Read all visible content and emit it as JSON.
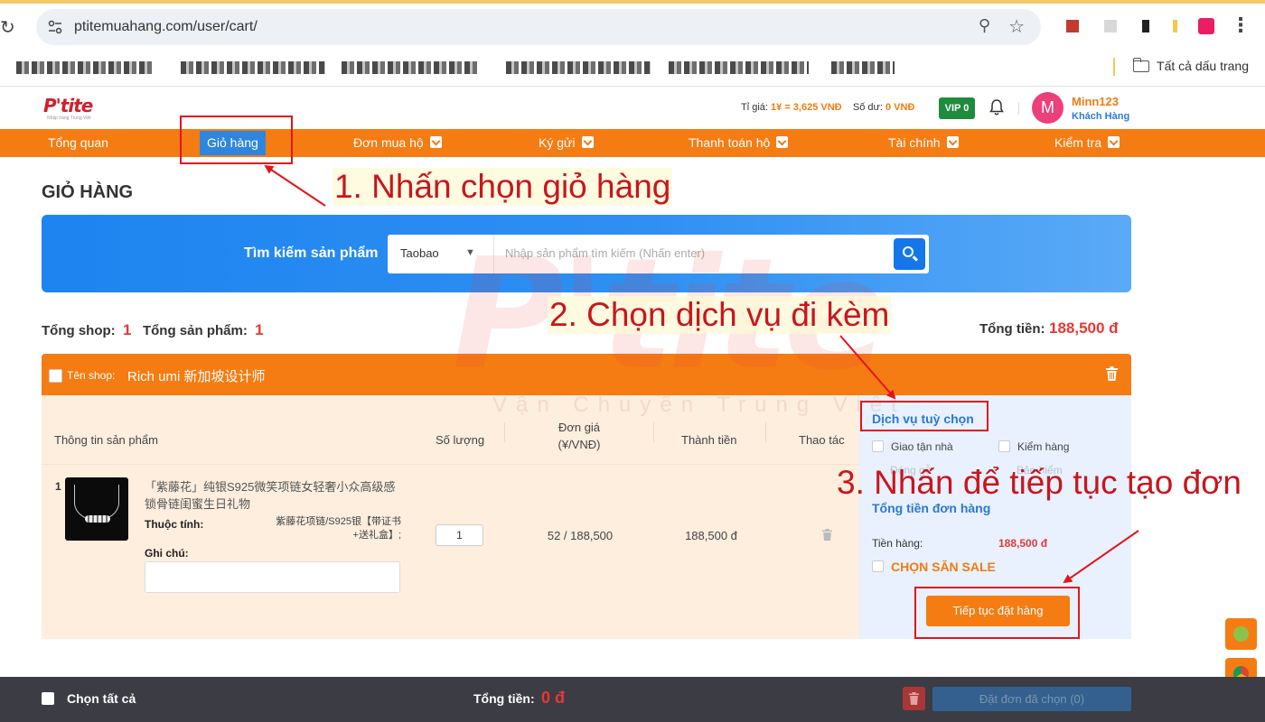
{
  "browser": {
    "url": "ptitemuahang.com/user/cart/",
    "bookmarks_all": "Tất cả dấu trang"
  },
  "header": {
    "logo": "P'tite",
    "logo_sub": "Nhập hàng Trung Việt",
    "rate_label": "Tỉ giá:",
    "rate_value": "1¥ = 3,625 VNĐ",
    "balance_label": "Số dư:",
    "balance_value": "0 VNĐ",
    "vip": "VIP 0",
    "avatar_letter": "M",
    "username": "Minn123",
    "user_role": "Khách Hàng"
  },
  "nav": {
    "items": [
      {
        "label": "Tổng quan"
      },
      {
        "label": "Giỏ hàng"
      },
      {
        "label": "Đơn mua hộ"
      },
      {
        "label": "Ký gửi"
      },
      {
        "label": "Thanh toán hộ"
      },
      {
        "label": "Tài chính"
      },
      {
        "label": "Kiểm tra"
      }
    ]
  },
  "page": {
    "title": "GIỎ HÀNG"
  },
  "search": {
    "label": "Tìm kiếm sản phẩm",
    "platform": "Taobao",
    "placeholder": "Nhập sản phẩm tìm kiếm (Nhấn enter)"
  },
  "summary": {
    "total_shop_label": "Tổng shop:",
    "total_shop_value": "1",
    "total_products_label": "Tổng sản phẩm:",
    "total_products_value": "1",
    "total_money_label": "Tổng tiền:",
    "total_money_value": "188,500 đ"
  },
  "shop": {
    "label": "Tên shop:",
    "name": "Rich umi 新加坡设计师"
  },
  "table": {
    "headers": {
      "product": "Thông tin sản phẩm",
      "quantity": "Số lượng",
      "unit_price": "Đơn giá",
      "unit_price_sub": "(¥/VNĐ)",
      "amount": "Thành tiền",
      "action": "Thao tác"
    },
    "rows": [
      {
        "index": "1",
        "name": "「紫藤花」纯银S925微笑项链女轻奢小众高级感锁骨链闺蜜生日礼物",
        "attr_label": "Thuộc tính:",
        "attr_value": "紫藤花项链/S925银【带证书+送礼盒】;",
        "note_label": "Ghi chú:",
        "quantity": "1",
        "unit_price": "52 / 188,500",
        "amount": "188,500 đ"
      }
    ]
  },
  "services": {
    "title": "Dịch vụ tuỳ chọn",
    "options": [
      "Giao tận nhà",
      "Kiểm hàng"
    ],
    "faded": [
      "Đóng gỗ",
      "Bảo hiểm"
    ],
    "order_total_title": "Tổng tiền đơn hàng",
    "goods_label": "Tiền hàng:",
    "goods_value": "188,500 đ",
    "sale_label": "CHỌN SĂN SALE",
    "continue": "Tiếp tục đặt hàng"
  },
  "footer": {
    "select_all": "Chọn tất cả",
    "total_label": "Tổng tiền:",
    "total_value": "0 đ",
    "order_selected": "Đặt đơn đã chọn (0)"
  },
  "annotations": {
    "step1": "1. Nhấn chọn giỏ hàng",
    "step2": "2. Chọn dịch vụ đi kèm",
    "step3": "3. Nhấn để tiếp tục tạo đơn"
  },
  "watermark": {
    "main": "P'tite",
    "sub": "Vận Chuyển Trung Việt"
  },
  "colors": {
    "primary_orange": "#f57c13",
    "primary_blue": "#2e86de",
    "price_red": "#e53935",
    "annotation_red": "#e3141b"
  }
}
